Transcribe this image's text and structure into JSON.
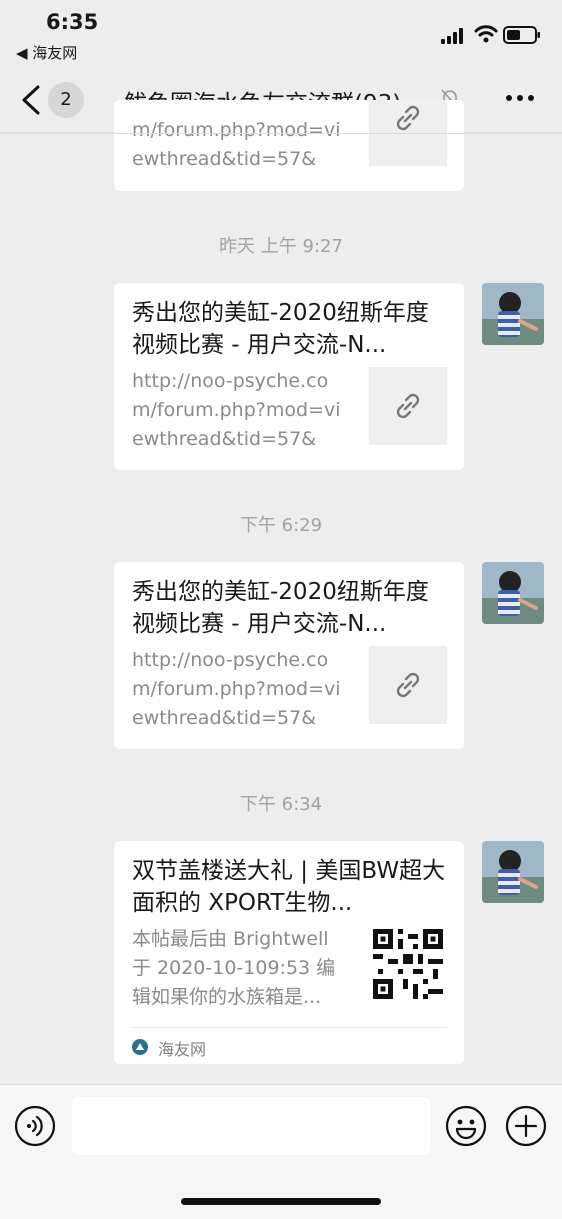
{
  "status_bar": {
    "time": "6:35",
    "back_app": "◀ 海友网"
  },
  "nav": {
    "unread_count": "2",
    "title": "鲅鱼圈海水鱼友交流群(93)"
  },
  "messages": [
    {
      "desc": "m/forum.php?mod=viewthread&tid=57&m..."
    },
    {
      "timestamp": "昨天 上午 9:27",
      "title": "秀出您的美缸-2020纽斯年度视频比赛 - 用户交流-N...",
      "desc": "http://noo-psyche.com/forum.php?mod=viewthread&tid=57&m..."
    },
    {
      "timestamp": "下午 6:29",
      "title": "秀出您的美缸-2020纽斯年度视频比赛 - 用户交流-N...",
      "desc": "http://noo-psyche.com/forum.php?mod=viewthread&tid=57&m..."
    },
    {
      "timestamp": "下午 6:34",
      "title": "双节盖楼送大礼 | 美国BW超大面积的 XPORT生物...",
      "desc": "本帖最后由 Brightwell于 2020-10-109:53 编辑如果你的水族箱是...",
      "source": "海友网"
    }
  ],
  "icons": {
    "link": "link-icon",
    "qr": "qr-code-icon",
    "mute": "bell-slash-icon",
    "voice": "voice-icon",
    "emoji": "emoji-icon",
    "plus": "plus-icon"
  },
  "colors": {
    "background": "#ededed",
    "bubble": "#ffffff",
    "meta_text": "#a3a3a3",
    "source_icon": "#2a6f8c"
  }
}
